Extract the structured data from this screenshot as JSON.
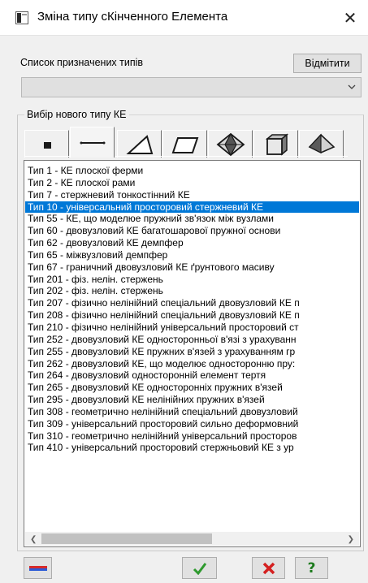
{
  "window": {
    "title": "Зміна типу сКінченного Елемента"
  },
  "assigned": {
    "label": "Список призначених типів",
    "unmark_label": "Відмітити",
    "combo_value": ""
  },
  "new_type": {
    "label": "Вибір нового типу КЕ",
    "tabs": [
      {
        "icon": "filled-square-icon"
      },
      {
        "icon": "bar-element-icon"
      },
      {
        "icon": "triangle-element-icon"
      },
      {
        "icon": "parallelogram-element-icon"
      },
      {
        "icon": "octahedron-element-icon"
      },
      {
        "icon": "cube-element-icon"
      },
      {
        "icon": "tetrahedron-element-icon"
      }
    ],
    "selected_index": 3,
    "items": [
      "Тип 1 - КЕ плоскої ферми",
      "Тип 2 - КЕ плоскої рами",
      "Тип 7 - стержневий тонкостінний КЕ",
      "Тип 10 - універсальний просторовий стержневий КЕ",
      "Тип 55 - КЕ, що моделюе пружний зв'язок між вузлами",
      "Тип 60 - двовузловий КЕ багатошарової пружної основи",
      "Тип 62 - двовузловий КЕ демпфер",
      "Тип 65 - міжвузловий демпфер",
      "Тип 67 - граничний двовузловий КЕ ґрунтового масиву",
      "Тип 201 -  фіз. нелін. стержень",
      "Тип 202 -  фіз. нелін. стержень",
      "Тип 207 - фізично нелінійний спеціальний двовузловий КЕ п",
      "Тип 208 - фізично нелінійний спеціальний двовузловий КЕ п",
      "Тип 210 - фізично нелінійний універсальний просторовий ст",
      "Тип 252 - двовузловий КЕ односторонньої в'язі з урахуванн",
      "Тип 255 - двовузловий КЕ пружних в'язей з урахуванням гр",
      "Тип 262 - двовузловий КЕ, що моделює односторонню пру:",
      "Тип 264  - двовузловий односторонній елемент тертя",
      "Тип 265 - двовузловий КЕ односторонніх пружних в'язей",
      "Тип 295 - двовузловий КЕ нелінійних пружних в'язей",
      "Тип 308 - геометрично нелінійний спеціальний двовузловий",
      "Тип 309 - універсальний просторовий сильно деформовний",
      "Тип 310 - геометрично нелінійний універсальний просторов",
      "Тип 410 - універсальний просторовий стержньовий КЕ з ур"
    ]
  },
  "buttons": {
    "icons": [
      "ruler-icon",
      "ok-check-icon",
      "cancel-x-icon",
      "help-question-icon"
    ],
    "help_glyph": "?"
  },
  "colors": {
    "selection": "#0078d7",
    "cancel": "#d42020",
    "check": "#2e9a2e",
    "help": "#1c7a1c"
  }
}
